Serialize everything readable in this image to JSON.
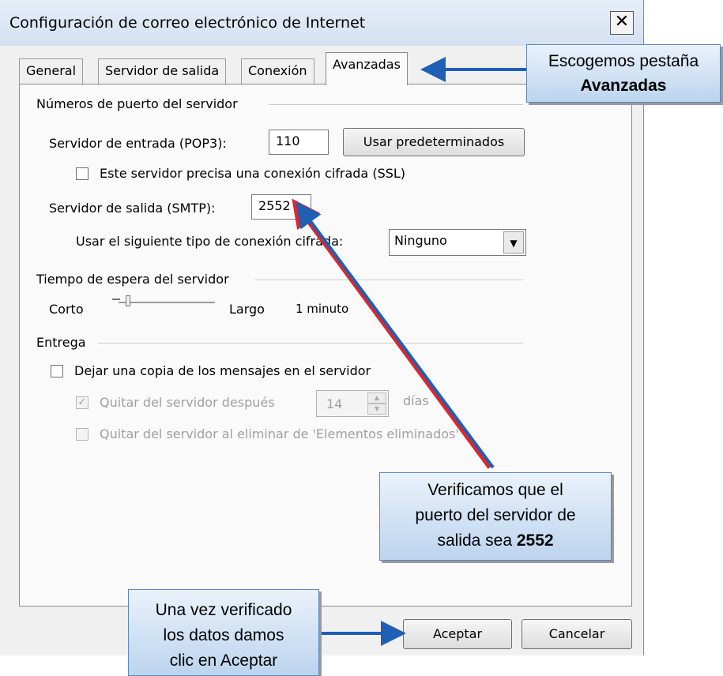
{
  "window": {
    "title": "Configuración de correo electrónico de Internet",
    "close_glyph": "✕"
  },
  "tabs": [
    {
      "label": "General",
      "active": false
    },
    {
      "label": "Servidor de salida",
      "active": false
    },
    {
      "label": "Conexión",
      "active": false
    },
    {
      "label": "Avanzadas",
      "active": true
    }
  ],
  "ports": {
    "group_title": "Números de puerto del servidor",
    "incoming_label": "Servidor de entrada (POP3):",
    "incoming_value": "110",
    "defaults_button": "Usar predeterminados",
    "ssl_checkbox_label": "Este servidor precisa una conexión cifrada (SSL)",
    "ssl_checked": false,
    "outgoing_label": "Servidor de salida (SMTP):",
    "outgoing_value": "2552",
    "encryption_label": "Usar el siguiente tipo de conexión cifrada:",
    "encryption_value": "Ninguno"
  },
  "timeout": {
    "group_title": "Tiempo de espera del servidor",
    "short_label": "Corto",
    "long_label": "Largo",
    "value_text": "1 minuto",
    "slider_level": 0.1
  },
  "delivery": {
    "group_title": "Entrega",
    "leave_copy_label": "Dejar una copia de los mensajes en el servidor",
    "leave_copy_checked": false,
    "remove_after_label": "Quitar del servidor después",
    "remove_after_checked": true,
    "days_value": "14",
    "days_label": "días",
    "remove_deleted_label": "Quitar del servidor al eliminar de 'Elementos eliminados'",
    "remove_deleted_checked": false
  },
  "buttons": {
    "ok": "Aceptar",
    "cancel": "Cancelar"
  },
  "annotations": {
    "tab_callout_line1": "Escogemos pestaña",
    "tab_callout_bold": "Avanzadas",
    "port_callout_line1": "Verificamos que el",
    "port_callout_line2": "puerto del servidor de",
    "port_callout_line3_prefix": "salida sea",
    "port_callout_bold": "2552",
    "accept_callout_line1": "Una vez verificado",
    "accept_callout_line2": "los datos damos",
    "accept_callout_line3": "clic en Aceptar",
    "arrow_color": "#1f5fb4"
  }
}
